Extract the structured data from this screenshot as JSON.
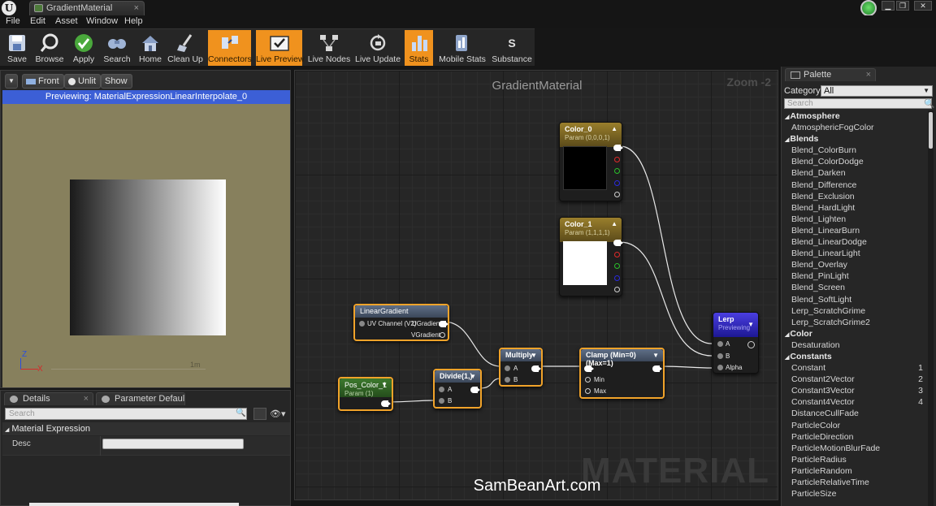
{
  "window": {
    "tab_title": "GradientMaterial",
    "tab_close": "×",
    "logo_letter": "U",
    "controls": [
      "▁",
      "❐",
      "✕"
    ]
  },
  "menu": [
    "File",
    "Edit",
    "Asset",
    "Window",
    "Help"
  ],
  "toolbar": {
    "buttons": [
      {
        "label": "Save",
        "icon": "save-icon",
        "active": false
      },
      {
        "label": "Browse",
        "icon": "browse-icon",
        "active": false
      },
      {
        "label": "Apply",
        "icon": "apply-icon",
        "active": false
      },
      {
        "label": "Search",
        "icon": "search-icon",
        "active": false
      },
      {
        "label": "Home",
        "icon": "home-icon",
        "active": false
      },
      {
        "label": "Clean Up",
        "icon": "clean-up-icon",
        "active": false
      },
      {
        "label": "Connectors",
        "icon": "connectors-icon",
        "active": true
      },
      {
        "label": "Live Preview",
        "icon": "live-preview-icon",
        "active": true
      },
      {
        "label": "Live Nodes",
        "icon": "live-nodes-icon",
        "active": false
      },
      {
        "label": "Live Update",
        "icon": "live-update-icon",
        "active": false
      },
      {
        "label": "Stats",
        "icon": "stats-icon",
        "active": true
      },
      {
        "label": "Mobile Stats",
        "icon": "mobile-stats-icon",
        "active": false
      },
      {
        "label": "Substance",
        "icon": "substance-icon",
        "active": false
      }
    ],
    "substance_glyph": "S"
  },
  "viewport": {
    "front_label": "Front",
    "unlit_label": "Unlit",
    "show_label": "Show",
    "dropdown_glyph": "▼",
    "banner": "Previewing: MaterialExpressionLinearInterpolate_0",
    "scale_label": "1m",
    "axis_z": "Z",
    "axis_x": "X",
    "preview_shapes": [
      "cylinder-icon",
      "sphere-icon",
      "plane-icon",
      "cube-icon",
      "mesh-icon"
    ],
    "active_shape": 3
  },
  "details": {
    "tab_details": "Details",
    "tab_params": "Parameter Default ",
    "tab_close": "×",
    "search_placeholder": "Search",
    "search_glyph": "🔍",
    "eye_glyph": "👁▾",
    "section": "Material Expression",
    "section_arrow": "◢",
    "row_label": "Desc",
    "row_value": ""
  },
  "graph": {
    "title": "GradientMaterial",
    "zoom": "Zoom -2",
    "watermark": "MATERIAL",
    "site": "SamBeanArt.com",
    "caret": "▼",
    "caret_up": "▲",
    "nodes": {
      "color0": {
        "title": "Color_0",
        "sub": "Param (0,0,0,1)",
        "swatch": "#000000"
      },
      "color1": {
        "title": "Color_1",
        "sub": "Param (1,1,1,1)",
        "swatch": "#ffffff"
      },
      "linear_gradient": {
        "title": "LinearGradient",
        "pin_in": "UV Channel (V2)",
        "out_u": "UGradient",
        "out_v": "VGradient"
      },
      "pos_color": {
        "title": "Pos_Color_1",
        "sub": "Param (1)"
      },
      "divide": {
        "title": "Divide(1,)",
        "a": "A",
        "b": "B"
      },
      "multiply": {
        "title": "Multiply",
        "a": "A",
        "b": "B"
      },
      "clamp": {
        "title": "Clamp (Min=0) (Max=1)",
        "min": "Min",
        "max": "Max"
      },
      "lerp": {
        "title": "Lerp",
        "sub": "Previewing",
        "a": "A",
        "b": "B",
        "alpha": "Alpha"
      }
    }
  },
  "palette": {
    "tab": "Palette",
    "tab_close": "×",
    "category_label": "Category:",
    "category_value": "All",
    "search_placeholder": "Search",
    "search_glyph": "🔍",
    "list": [
      {
        "type": "cat",
        "label": "Atmosphere"
      },
      {
        "type": "item",
        "label": "AtmosphericFogColor"
      },
      {
        "type": "cat",
        "label": "Blends"
      },
      {
        "type": "item",
        "label": "Blend_ColorBurn"
      },
      {
        "type": "item",
        "label": "Blend_ColorDodge"
      },
      {
        "type": "item",
        "label": "Blend_Darken"
      },
      {
        "type": "item",
        "label": "Blend_Difference"
      },
      {
        "type": "item",
        "label": "Blend_Exclusion"
      },
      {
        "type": "item",
        "label": "Blend_HardLight"
      },
      {
        "type": "item",
        "label": "Blend_Lighten"
      },
      {
        "type": "item",
        "label": "Blend_LinearBurn"
      },
      {
        "type": "item",
        "label": "Blend_LinearDodge"
      },
      {
        "type": "item",
        "label": "Blend_LinearLight"
      },
      {
        "type": "item",
        "label": "Blend_Overlay"
      },
      {
        "type": "item",
        "label": "Blend_PinLight"
      },
      {
        "type": "item",
        "label": "Blend_Screen"
      },
      {
        "type": "item",
        "label": "Blend_SoftLight"
      },
      {
        "type": "item",
        "label": "Lerp_ScratchGrime"
      },
      {
        "type": "item",
        "label": "Lerp_ScratchGrime2"
      },
      {
        "type": "cat",
        "label": "Color"
      },
      {
        "type": "item",
        "label": "Desaturation"
      },
      {
        "type": "cat",
        "label": "Constants"
      },
      {
        "type": "item",
        "label": "Constant",
        "key": "1"
      },
      {
        "type": "item",
        "label": "Constant2Vector",
        "key": "2"
      },
      {
        "type": "item",
        "label": "Constant3Vector",
        "key": "3"
      },
      {
        "type": "item",
        "label": "Constant4Vector",
        "key": "4"
      },
      {
        "type": "item",
        "label": "DistanceCullFade"
      },
      {
        "type": "item",
        "label": "ParticleColor"
      },
      {
        "type": "item",
        "label": "ParticleDirection"
      },
      {
        "type": "item",
        "label": "ParticleMotionBlurFade"
      },
      {
        "type": "item",
        "label": "ParticleRadius"
      },
      {
        "type": "item",
        "label": "ParticleRandom"
      },
      {
        "type": "item",
        "label": "ParticleRelativeTime"
      },
      {
        "type": "item",
        "label": "ParticleSize"
      }
    ]
  }
}
